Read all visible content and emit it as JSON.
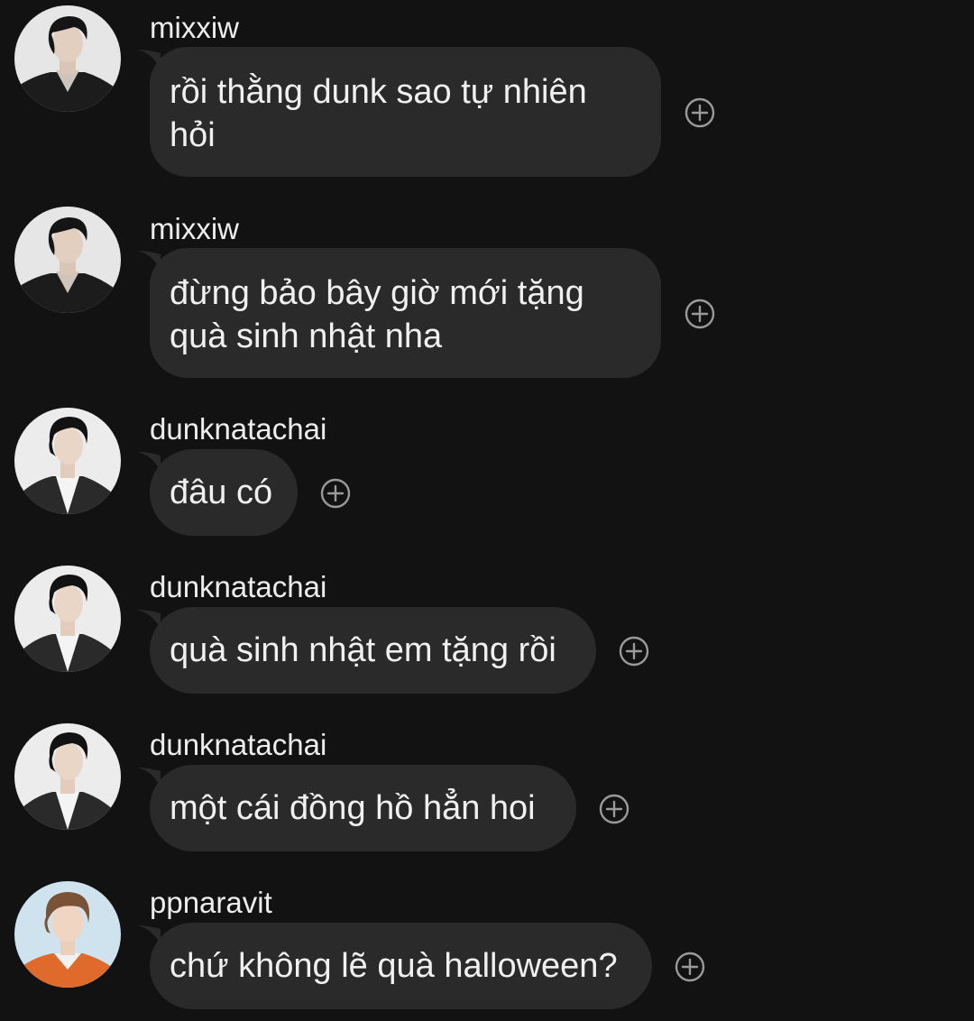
{
  "messages": [
    {
      "username": "mixxiw",
      "text": "rồi thằng dunk sao tự nhiên hỏi",
      "avatar": "avatar-mixxiw"
    },
    {
      "username": "mixxiw",
      "text": "đừng bảo bây giờ mới tặng quà sinh nhật nha",
      "avatar": "avatar-mixxiw"
    },
    {
      "username": "dunknatachai",
      "text": "đâu có",
      "avatar": "avatar-dunknatachai"
    },
    {
      "username": "dunknatachai",
      "text": "quà sinh nhật em tặng rồi",
      "avatar": "avatar-dunknatachai"
    },
    {
      "username": "dunknatachai",
      "text": "một cái đồng hồ hẳn hoi",
      "avatar": "avatar-dunknatachai"
    },
    {
      "username": "ppnaravit",
      "text": "chứ không lẽ quà halloween?",
      "avatar": "avatar-ppnaravit"
    }
  ],
  "icons": {
    "reaction": "add-reaction-icon"
  },
  "colors": {
    "background": "#121212",
    "bubble": "#2a2a2a",
    "text": "#f0f0f0",
    "icon": "#9a9a9a"
  }
}
